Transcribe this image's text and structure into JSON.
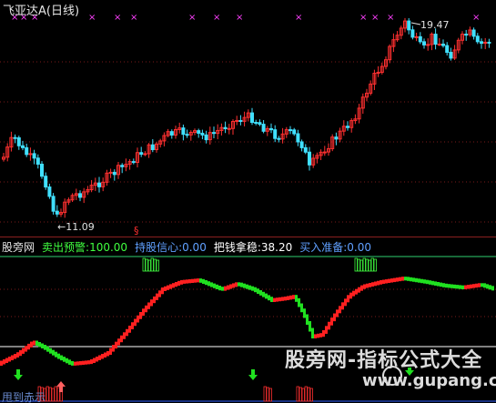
{
  "header": {
    "title": "飞亚达A",
    "period": "(日线)"
  },
  "price_chart": {
    "high_label": "19.47",
    "low_label": "11.09",
    "marker_symbol": "§",
    "colors": {
      "up": "#ff3030",
      "down": "#40e0ff",
      "cross": "#ff40ff",
      "marker": "#ff3030"
    }
  },
  "indicator": {
    "name": "股旁网",
    "items": [
      {
        "label": "卖出预警:",
        "value": "100.00",
        "color": "#40ff40"
      },
      {
        "label": "持股信心:",
        "value": "0.00",
        "color": "#60a0ff"
      },
      {
        "label": "把钱拿稳:",
        "value": "38.20",
        "color": "#ffffff"
      },
      {
        "label": "买入准备:",
        "value": "0.00",
        "color": "#60a0ff"
      }
    ],
    "colors": {
      "rise": "#ff2020",
      "fall": "#20e020",
      "line": "#ffffff",
      "upper_line": "#30d070"
    }
  },
  "footer_cut_text": "甩到赤示",
  "watermark": {
    "title": "股旁网-指标公式大全",
    "url": "www.gupang.com"
  }
}
